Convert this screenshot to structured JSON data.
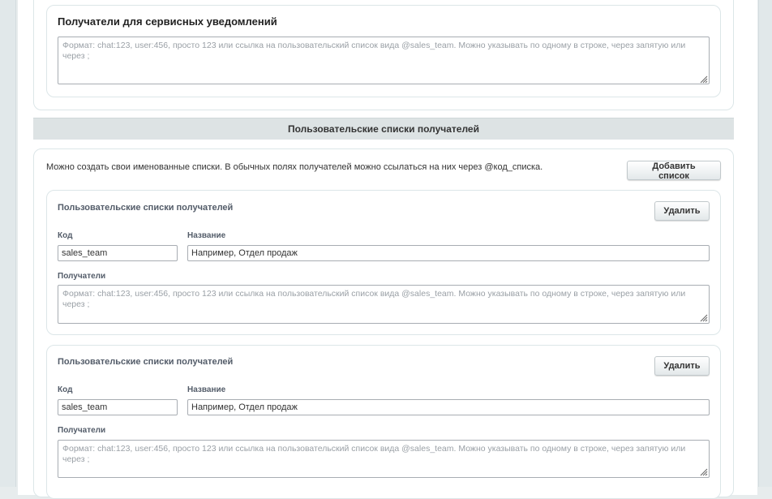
{
  "service_recipients": {
    "title": "Получатели для сервисных уведомлений",
    "placeholder": "Формат: chat:123, user:456, просто 123 или ссылка на пользовательский список вида @sales_team. Можно указывать по одному в строке, через запятую или через ;"
  },
  "custom_lists": {
    "section_title": "Пользовательские списки получателей",
    "hint": "Можно создать свои именованные списки. В обычных полях получателей можно ссылаться на них через @код_списка.",
    "add_button": "Добавить список",
    "lists": [
      {
        "title": "Пользовательские списки получателей",
        "delete_button": "Удалить",
        "code_label": "Код",
        "code_value": "sales_team",
        "name_label": "Название",
        "name_placeholder": "Например, Отдел продаж",
        "recipients_label": "Получатели",
        "recipients_placeholder": "Формат: chat:123, user:456, просто 123 или ссылка на пользовательский список вида @sales_team. Можно указывать по одному в строке, через запятую или через ;"
      },
      {
        "title": "Пользовательские списки получателей",
        "delete_button": "Удалить",
        "code_label": "Код",
        "code_value": "sales_team",
        "name_label": "Название",
        "name_placeholder": "Например, Отдел продаж",
        "recipients_label": "Получатели",
        "recipients_placeholder": "Формат: chat:123, user:456, просто 123 или ссылка на пользовательский список вида @sales_team. Можно указывать по одному в строке, через запятую или через ;"
      }
    ]
  }
}
